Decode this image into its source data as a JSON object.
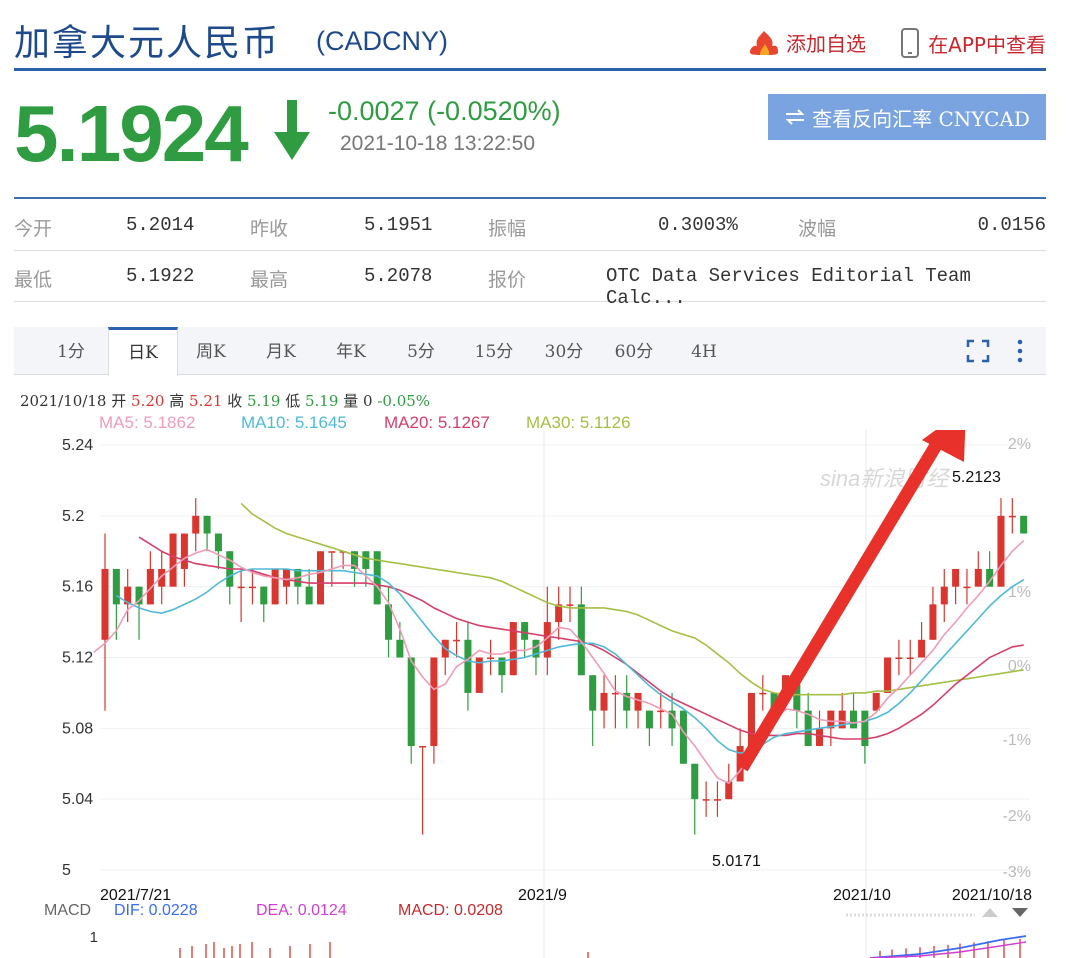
{
  "header": {
    "title": "加拿大元人民币",
    "code": "(CADCNY)",
    "add_watch": "添加自选",
    "view_app": "在APP中查看"
  },
  "quote": {
    "price": "5.1924",
    "change": "-0.0027 (-0.0520%)",
    "timestamp": "2021-10-18 13:22:50",
    "reverse_button": "查看反向汇率 CNYCAD"
  },
  "stats": {
    "open_label": "今开",
    "open": "5.2014",
    "prev_close_label": "昨收",
    "prev_close": "5.1951",
    "amplitude_label": "振幅",
    "amplitude": "0.3003%",
    "volatility_label": "波幅",
    "volatility": "0.0156",
    "low_label": "最低",
    "low": "5.1922",
    "high_label": "最高",
    "high": "5.2078",
    "quote_label": "报价",
    "quote_source": "OTC Data Services Editorial Team Calc..."
  },
  "tabs": [
    "1分",
    "日K",
    "周K",
    "月K",
    "年K",
    "5分",
    "15分",
    "30分",
    "60分",
    "4H"
  ],
  "active_tab": "日K",
  "bar_info": {
    "date": "2021/10/18",
    "open_label": "开",
    "open": "5.20",
    "high_label": "高",
    "high": "5.21",
    "close_label": "收",
    "close": "5.19",
    "low_label": "低",
    "low": "5.19",
    "vol_label": "量",
    "vol": "0",
    "pct": "-0.05%"
  },
  "ma_legend": {
    "ma5": "MA5: 5.1862",
    "ma10": "MA10: 5.1645",
    "ma20": "MA20: 5.1267",
    "ma30": "MA30: 5.1126"
  },
  "macd_legend": {
    "label": "MACD",
    "dif": "DIF: 0.0228",
    "dea": "DEA: 0.0124",
    "macd": "MACD: 0.0208",
    "axis_top": "1"
  },
  "watermark": "sina新浪财经",
  "colors": {
    "up": "#d9362f",
    "down": "#2f9c41",
    "ma5": "#ef9cb8",
    "ma10": "#4fb9d8",
    "ma20": "#d63f6a",
    "ma30": "#a5bf45",
    "accent": "#2c62ac"
  },
  "chart_data": {
    "type": "candlestick",
    "y_ticks": [
      "5.24",
      "5.2",
      "5.16",
      "5.12",
      "5.08",
      "5.04",
      "5"
    ],
    "y_range": [
      5.0,
      5.24
    ],
    "pct_ticks": [
      "2%",
      "1%",
      "0%",
      "-1%",
      "-2%",
      "-3%"
    ],
    "x_labels": [
      "2021/7/21",
      "2021/9",
      "2021/10",
      "2021/10/18"
    ],
    "annotations": {
      "high": "5.2123",
      "low": "5.0171"
    },
    "candles": [
      [
        5.13,
        5.17,
        5.19,
        5.09
      ],
      [
        5.17,
        5.15,
        5.16,
        5.13
      ],
      [
        5.15,
        5.16,
        5.17,
        5.14
      ],
      [
        5.16,
        5.15,
        5.16,
        5.13
      ],
      [
        5.15,
        5.17,
        5.18,
        5.15
      ],
      [
        5.16,
        5.17,
        5.18,
        5.15
      ],
      [
        5.16,
        5.19,
        5.19,
        5.16
      ],
      [
        5.17,
        5.19,
        5.19,
        5.16
      ],
      [
        5.19,
        5.2,
        5.21,
        5.18
      ],
      [
        5.2,
        5.19,
        5.2,
        5.18
      ],
      [
        5.19,
        5.18,
        5.19,
        5.17
      ],
      [
        5.18,
        5.16,
        5.18,
        5.15
      ],
      [
        5.16,
        5.16,
        5.17,
        5.14
      ],
      [
        5.16,
        5.16,
        5.17,
        5.15
      ],
      [
        5.16,
        5.15,
        5.16,
        5.14
      ],
      [
        5.15,
        5.17,
        5.17,
        5.15
      ],
      [
        5.16,
        5.17,
        5.17,
        5.15
      ],
      [
        5.17,
        5.16,
        5.17,
        5.15
      ],
      [
        5.16,
        5.15,
        5.17,
        5.15
      ],
      [
        5.15,
        5.18,
        5.18,
        5.15
      ],
      [
        5.18,
        5.18,
        5.18,
        5.16
      ],
      [
        5.18,
        5.18,
        5.18,
        5.17
      ],
      [
        5.18,
        5.17,
        5.18,
        5.16
      ],
      [
        5.18,
        5.17,
        5.18,
        5.16
      ],
      [
        5.18,
        5.15,
        5.18,
        5.15
      ],
      [
        5.15,
        5.13,
        5.16,
        5.12
      ],
      [
        5.13,
        5.12,
        5.14,
        5.12
      ],
      [
        5.12,
        5.07,
        5.12,
        5.06
      ],
      [
        5.07,
        5.07,
        5.07,
        5.02
      ],
      [
        5.07,
        5.12,
        5.12,
        5.06
      ],
      [
        5.12,
        5.13,
        5.13,
        5.11
      ],
      [
        5.13,
        5.13,
        5.14,
        5.12
      ],
      [
        5.13,
        5.1,
        5.14,
        5.09
      ],
      [
        5.1,
        5.12,
        5.12,
        5.1
      ],
      [
        5.12,
        5.12,
        5.13,
        5.11
      ],
      [
        5.12,
        5.11,
        5.12,
        5.1
      ],
      [
        5.11,
        5.14,
        5.14,
        5.11
      ],
      [
        5.14,
        5.13,
        5.14,
        5.12
      ],
      [
        5.13,
        5.12,
        5.13,
        5.11
      ],
      [
        5.12,
        5.14,
        5.16,
        5.11
      ],
      [
        5.14,
        5.15,
        5.16,
        5.13
      ],
      [
        5.15,
        5.15,
        5.16,
        5.14
      ],
      [
        5.15,
        5.11,
        5.16,
        5.11
      ],
      [
        5.11,
        5.09,
        5.11,
        5.07
      ],
      [
        5.09,
        5.1,
        5.11,
        5.08
      ],
      [
        5.1,
        5.1,
        5.11,
        5.08
      ],
      [
        5.1,
        5.09,
        5.11,
        5.08
      ],
      [
        5.09,
        5.1,
        5.1,
        5.08
      ],
      [
        5.09,
        5.08,
        5.09,
        5.07
      ],
      [
        5.09,
        5.09,
        5.1,
        5.08
      ],
      [
        5.09,
        5.08,
        5.1,
        5.07
      ],
      [
        5.09,
        5.06,
        5.09,
        5.06
      ],
      [
        5.06,
        5.04,
        5.06,
        5.02
      ],
      [
        5.04,
        5.04,
        5.05,
        5.03
      ],
      [
        5.04,
        5.04,
        5.05,
        5.03
      ],
      [
        5.04,
        5.05,
        5.06,
        5.04
      ],
      [
        5.05,
        5.07,
        5.08,
        5.05
      ],
      [
        5.07,
        5.1,
        5.1,
        5.06
      ],
      [
        5.1,
        5.1,
        5.11,
        5.09
      ],
      [
        5.1,
        5.09,
        5.1,
        5.09
      ],
      [
        5.1,
        5.11,
        5.11,
        5.09
      ],
      [
        5.11,
        5.09,
        5.11,
        5.08
      ],
      [
        5.09,
        5.07,
        5.1,
        5.07
      ],
      [
        5.07,
        5.08,
        5.09,
        5.07
      ],
      [
        5.08,
        5.09,
        5.09,
        5.07
      ],
      [
        5.08,
        5.09,
        5.1,
        5.08
      ],
      [
        5.09,
        5.08,
        5.1,
        5.08
      ],
      [
        5.09,
        5.07,
        5.09,
        5.06
      ],
      [
        5.09,
        5.1,
        5.1,
        5.09
      ],
      [
        5.1,
        5.12,
        5.12,
        5.1
      ],
      [
        5.12,
        5.12,
        5.13,
        5.11
      ],
      [
        5.12,
        5.12,
        5.13,
        5.11
      ],
      [
        5.12,
        5.13,
        5.14,
        5.12
      ],
      [
        5.13,
        5.15,
        5.16,
        5.13
      ],
      [
        5.15,
        5.16,
        5.17,
        5.14
      ],
      [
        5.16,
        5.17,
        5.17,
        5.15
      ],
      [
        5.16,
        5.16,
        5.17,
        5.15
      ],
      [
        5.16,
        5.17,
        5.18,
        5.16
      ],
      [
        5.17,
        5.16,
        5.18,
        5.16
      ],
      [
        5.16,
        5.2,
        5.21,
        5.16
      ],
      [
        5.2,
        5.2,
        5.21,
        5.19
      ],
      [
        5.2,
        5.19,
        5.2,
        5.19
      ]
    ],
    "ma5": [
      5.123,
      5.128,
      5.135,
      5.147,
      5.152,
      5.159,
      5.166,
      5.171,
      5.176,
      5.179,
      5.181,
      5.178,
      5.175,
      5.171,
      5.168,
      5.166,
      5.165,
      5.164,
      5.165,
      5.167,
      5.168,
      5.17,
      5.172,
      5.172,
      5.166,
      5.16,
      5.151,
      5.136,
      5.118,
      5.109,
      5.102,
      5.105,
      5.115,
      5.119,
      5.124,
      5.122,
      5.122,
      5.124,
      5.124,
      5.126,
      5.131,
      5.137,
      5.136,
      5.129,
      5.12,
      5.111,
      5.101,
      5.098,
      5.096,
      5.094,
      5.091,
      5.088,
      5.078,
      5.07,
      5.061,
      5.052,
      5.049,
      5.056,
      5.066,
      5.076,
      5.084,
      5.091,
      5.09,
      5.088,
      5.085,
      5.084,
      5.084,
      5.083,
      5.084,
      5.089,
      5.097,
      5.103,
      5.11,
      5.117,
      5.124,
      5.133,
      5.14,
      5.148,
      5.155,
      5.163,
      5.172,
      5.18,
      5.186
    ],
    "ma10": [
      5.155,
      5.151,
      5.148,
      5.146,
      5.145,
      5.147,
      5.15,
      5.153,
      5.157,
      5.162,
      5.166,
      5.169,
      5.17,
      5.17,
      5.17,
      5.17,
      5.169,
      5.169,
      5.169,
      5.169,
      5.169,
      5.168,
      5.167,
      5.166,
      5.162,
      5.156,
      5.148,
      5.14,
      5.132,
      5.125,
      5.121,
      5.118,
      5.117,
      5.118,
      5.118,
      5.119,
      5.12,
      5.122,
      5.124,
      5.126,
      5.127,
      5.128,
      5.128,
      5.126,
      5.122,
      5.116,
      5.11,
      5.104,
      5.099,
      5.095,
      5.091,
      5.086,
      5.08,
      5.073,
      5.068,
      5.066,
      5.067,
      5.071,
      5.075,
      5.077,
      5.078,
      5.079,
      5.08,
      5.081,
      5.082,
      5.083,
      5.084,
      5.086,
      5.089,
      5.094,
      5.1,
      5.107,
      5.114,
      5.121,
      5.128,
      5.135,
      5.142,
      5.149,
      5.155,
      5.16,
      5.164
    ],
    "ma20": [
      5.188,
      5.184,
      5.18,
      5.177,
      5.175,
      5.173,
      5.172,
      5.171,
      5.17,
      5.17,
      5.169,
      5.167,
      5.165,
      5.164,
      5.163,
      5.162,
      5.162,
      5.162,
      5.162,
      5.162,
      5.162,
      5.161,
      5.16,
      5.158,
      5.155,
      5.152,
      5.148,
      5.145,
      5.142,
      5.14,
      5.138,
      5.137,
      5.136,
      5.135,
      5.134,
      5.133,
      5.132,
      5.131,
      5.13,
      5.129,
      5.127,
      5.124,
      5.12,
      5.116,
      5.111,
      5.106,
      5.101,
      5.097,
      5.094,
      5.091,
      5.088,
      5.085,
      5.082,
      5.079,
      5.077,
      5.076,
      5.076,
      5.076,
      5.077,
      5.077,
      5.076,
      5.075,
      5.074,
      5.074,
      5.074,
      5.075,
      5.077,
      5.08,
      5.084,
      5.088,
      5.093,
      5.099,
      5.105,
      5.11,
      5.115,
      5.12,
      5.123,
      5.126,
      5.127
    ],
    "ma30": [
      5.207,
      5.201,
      5.197,
      5.193,
      5.19,
      5.188,
      5.186,
      5.184,
      5.182,
      5.18,
      5.178,
      5.176,
      5.175,
      5.174,
      5.173,
      5.172,
      5.171,
      5.17,
      5.169,
      5.168,
      5.167,
      5.166,
      5.165,
      5.163,
      5.16,
      5.157,
      5.154,
      5.151,
      5.149,
      5.148,
      5.148,
      5.148,
      5.148,
      5.147,
      5.146,
      5.144,
      5.141,
      5.138,
      5.135,
      5.133,
      5.131,
      5.127,
      5.122,
      5.117,
      5.111,
      5.106,
      5.102,
      5.1,
      5.099,
      5.099,
      5.099,
      5.099,
      5.099,
      5.099,
      5.1,
      5.1,
      5.101,
      5.101,
      5.102,
      5.103,
      5.104,
      5.105,
      5.106,
      5.107,
      5.108,
      5.109,
      5.11,
      5.111,
      5.112,
      5.113
    ]
  }
}
